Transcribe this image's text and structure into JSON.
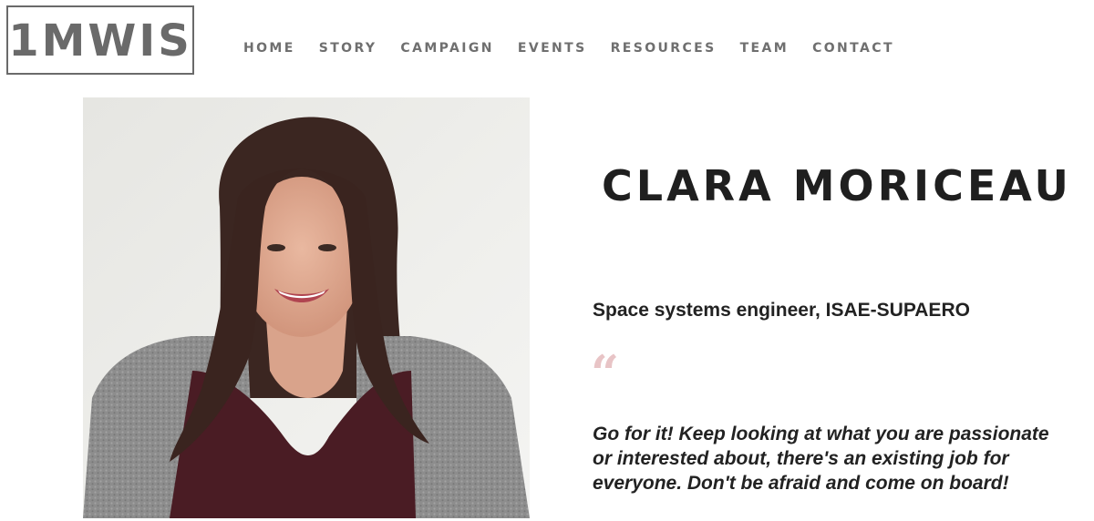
{
  "header": {
    "logo_text": "1MWIS",
    "nav": [
      {
        "label": "HOME"
      },
      {
        "label": "STORY"
      },
      {
        "label": "CAMPAIGN"
      },
      {
        "label": "EVENTS"
      },
      {
        "label": "RESOURCES"
      },
      {
        "label": "TEAM"
      },
      {
        "label": "CONTACT"
      }
    ]
  },
  "profile": {
    "name": "CLARA MORICEAU",
    "role": "Space systems engineer, ISAE-SUPAERO",
    "quote_mark": "“",
    "quote": "Go for it! Keep looking at what you are passionate or interested about, there's an existing job for everyone. Don't be afraid and come on board!",
    "photo": "portrait-photo"
  },
  "colors": {
    "logo": "#6a6a6a",
    "nav": "#6f6f6f",
    "text": "#222222",
    "quote_mark": "#e8c4c6"
  }
}
